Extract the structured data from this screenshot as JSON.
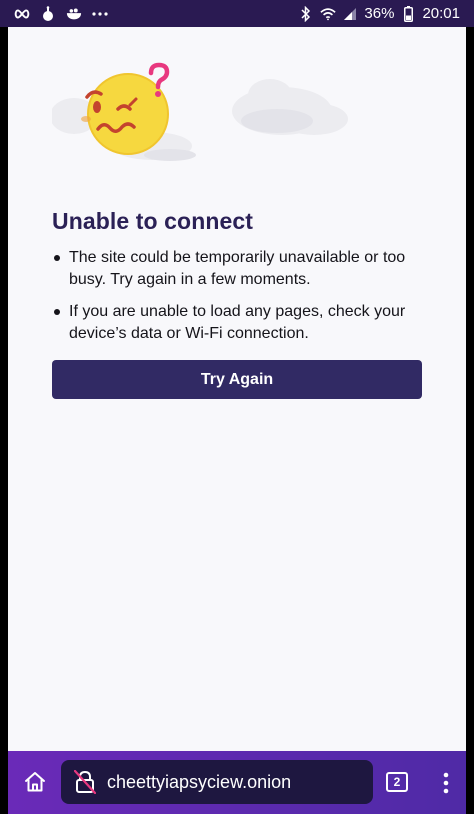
{
  "status_bar": {
    "left_icons": [
      "infinity-icon",
      "bomb-icon",
      "bowl-icon",
      "more-dots-icon"
    ],
    "right_icons": [
      "bluetooth-icon",
      "wifi-icon",
      "signal-icon",
      "battery-icon"
    ],
    "battery": "36%",
    "time": "20:01"
  },
  "error_page": {
    "illustration": "confused-face-icon",
    "title": "Unable to connect",
    "bullets": [
      "The site could be temporarily unavailable or too busy. Try again in a few moments.",
      "If you are unable to load any pages, check your device’s data or Wi-Fi connection."
    ],
    "button_label": "Try Again"
  },
  "toolbar": {
    "home_icon": "home-icon",
    "lock_icon": "broken-lock-icon",
    "url": "cheettyiapsyciew.onion",
    "tab_count": "2",
    "menu_icon": "kebab-menu-icon"
  },
  "colors": {
    "title": "#2b2156",
    "button": "#312a64",
    "toolbar_start": "#6a2ab8",
    "toolbar_end": "#4f2aa6",
    "url_field": "#1e1740",
    "status_bar": "#2a1a52"
  }
}
